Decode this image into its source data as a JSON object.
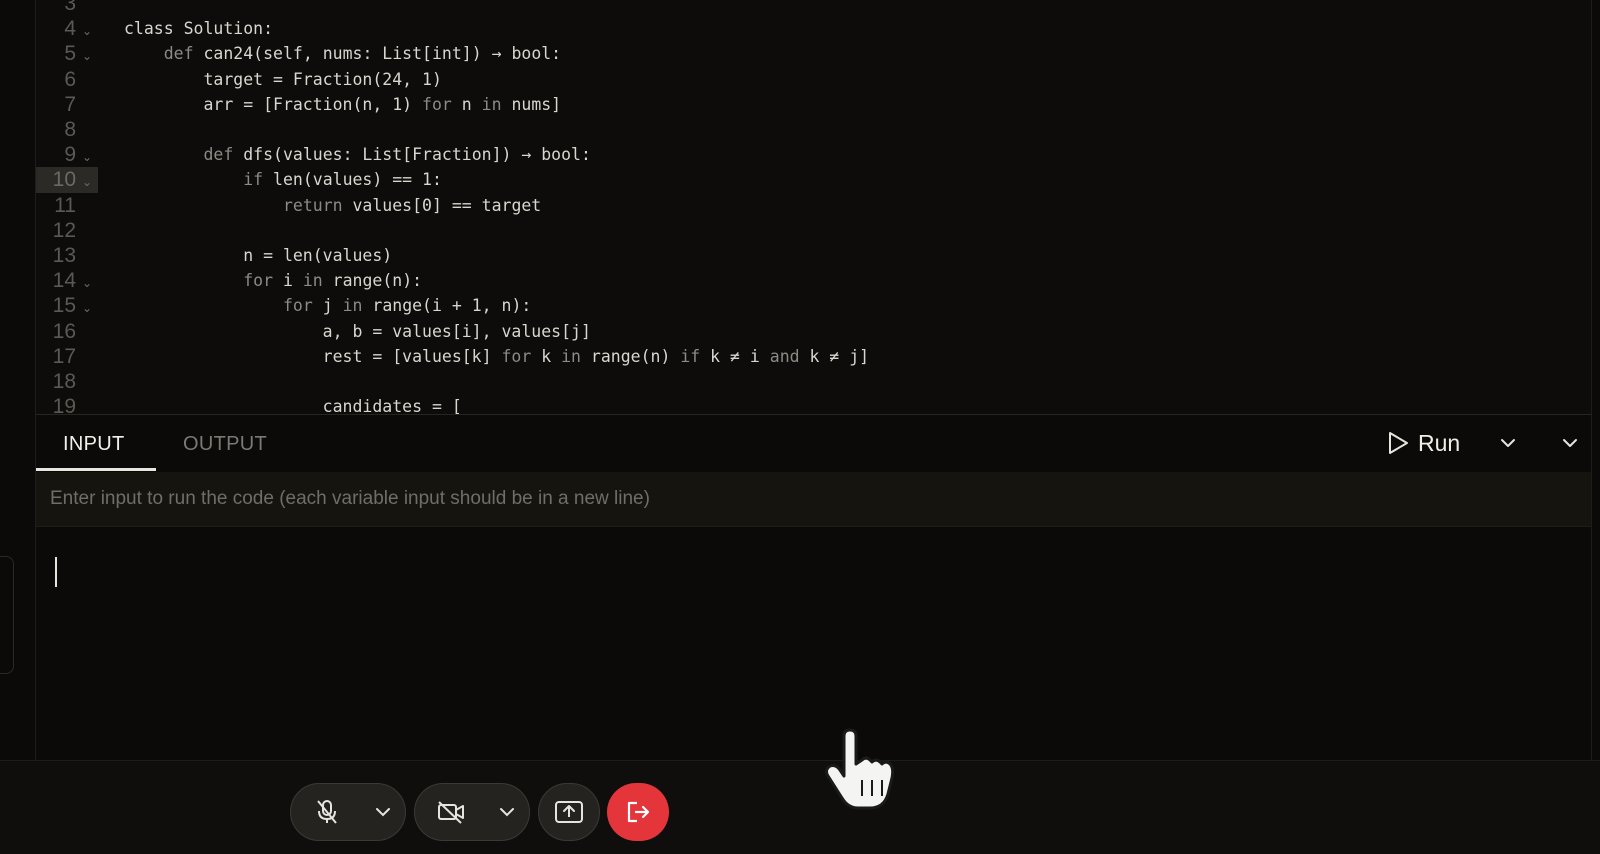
{
  "editor": {
    "lines": [
      {
        "num": "3",
        "segments": []
      },
      {
        "num": "4",
        "fold": true,
        "segments": [
          {
            "t": "class Solution:"
          }
        ]
      },
      {
        "num": "5",
        "fold": true,
        "segments": [
          {
            "t": "    "
          },
          {
            "t": "def",
            "k": 1
          },
          {
            "t": " can24(self, nums: List[int]) → bool:"
          }
        ]
      },
      {
        "num": "6",
        "segments": [
          {
            "t": "        target = Fraction(24, 1)"
          }
        ]
      },
      {
        "num": "7",
        "segments": [
          {
            "t": "        arr = [Fraction(n, 1) "
          },
          {
            "t": "for",
            "k": 1
          },
          {
            "t": " n "
          },
          {
            "t": "in",
            "k": 1
          },
          {
            "t": " nums]"
          }
        ]
      },
      {
        "num": "8",
        "segments": []
      },
      {
        "num": "9",
        "fold": true,
        "segments": [
          {
            "t": "        "
          },
          {
            "t": "def",
            "k": 1
          },
          {
            "t": " dfs(values: List[Fraction]) → bool:"
          }
        ]
      },
      {
        "num": "10",
        "fold": true,
        "active": true,
        "segments": [
          {
            "t": "            "
          },
          {
            "t": "if",
            "k": 1
          },
          {
            "t": " len(values) == 1:"
          }
        ]
      },
      {
        "num": "11",
        "segments": [
          {
            "t": "                "
          },
          {
            "t": "return",
            "k": 1
          },
          {
            "t": " values[0] == target"
          }
        ]
      },
      {
        "num": "12",
        "segments": []
      },
      {
        "num": "13",
        "segments": [
          {
            "t": "            n = len(values)"
          }
        ]
      },
      {
        "num": "14",
        "fold": true,
        "segments": [
          {
            "t": "            "
          },
          {
            "t": "for",
            "k": 1
          },
          {
            "t": " i "
          },
          {
            "t": "in",
            "k": 1
          },
          {
            "t": " range(n):"
          }
        ]
      },
      {
        "num": "15",
        "fold": true,
        "segments": [
          {
            "t": "                "
          },
          {
            "t": "for",
            "k": 1
          },
          {
            "t": " j "
          },
          {
            "t": "in",
            "k": 1
          },
          {
            "t": " range(i + 1, n):"
          }
        ]
      },
      {
        "num": "16",
        "segments": [
          {
            "t": "                    a, b = values[i], values[j]"
          }
        ]
      },
      {
        "num": "17",
        "segments": [
          {
            "t": "                    rest = [values[k] "
          },
          {
            "t": "for",
            "k": 1
          },
          {
            "t": " k "
          },
          {
            "t": "in",
            "k": 1
          },
          {
            "t": " range(n) "
          },
          {
            "t": "if",
            "k": 1
          },
          {
            "t": " k ≠ i "
          },
          {
            "t": "and",
            "k": 1
          },
          {
            "t": " k ≠ j]"
          }
        ]
      },
      {
        "num": "18",
        "segments": []
      },
      {
        "num": "19",
        "segments": [
          {
            "t": "                    candidates = ["
          }
        ]
      }
    ]
  },
  "panel": {
    "tabs": {
      "input": "INPUT",
      "output": "OUTPUT"
    },
    "run_label": "Run",
    "placeholder": "Enter input to run the code (each variable input should be in a new line)",
    "input_value": ""
  },
  "callbar": {
    "icons": [
      "mic-off-icon",
      "camera-off-icon",
      "share-screen-icon",
      "leave-icon"
    ],
    "leave_color": "#e4353a"
  }
}
